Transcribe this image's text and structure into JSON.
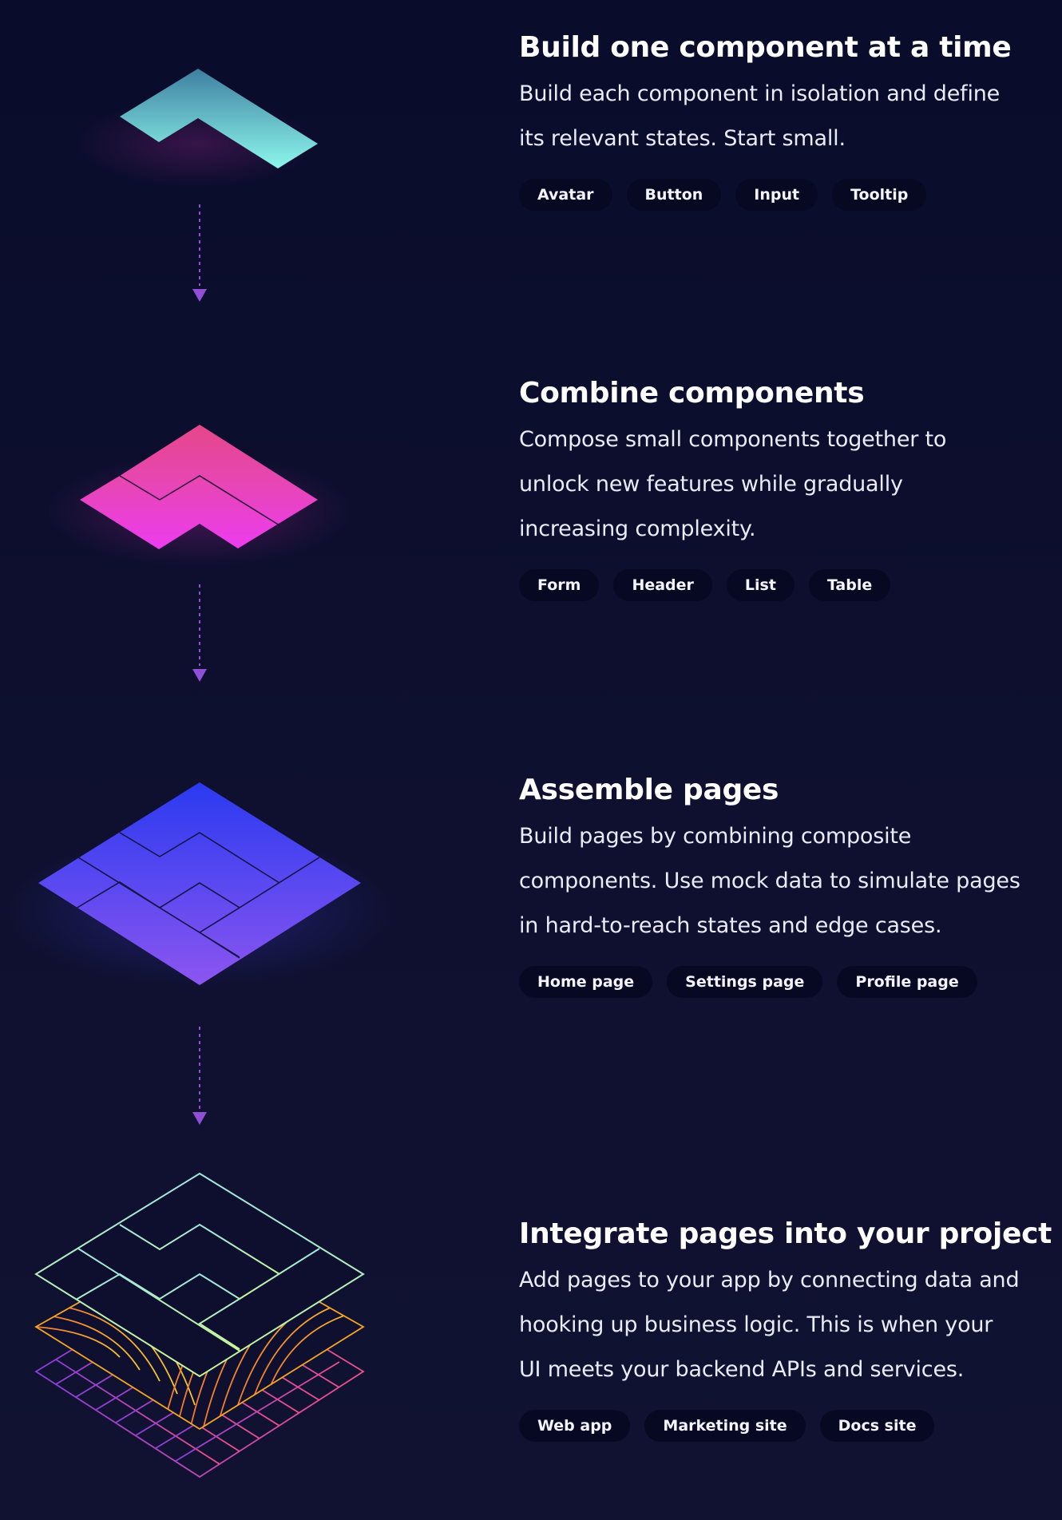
{
  "steps": [
    {
      "title": "Build one component at a time",
      "lines": [
        "Build each component in isolation and define",
        "its relevant states. Start small."
      ],
      "tags": [
        "Avatar",
        "Button",
        "Input",
        "Tooltip"
      ]
    },
    {
      "title": "Combine components",
      "lines": [
        "Compose small components together to",
        "unlock new features while gradually",
        "increasing complexity."
      ],
      "tags": [
        "Form",
        "Header",
        "List",
        "Table"
      ]
    },
    {
      "title": "Assemble pages",
      "lines": [
        "Build pages by combining composite",
        "components. Use mock data to simulate pages",
        "in hard-to-reach states and edge cases."
      ],
      "tags": [
        "Home page",
        "Settings page",
        "Profile page"
      ]
    },
    {
      "title": "Integrate pages into your project",
      "lines": [
        "Add pages to your app by connecting data and",
        "hooking up business logic. This is when your",
        "UI meets your backend APIs and services."
      ],
      "tags": [
        "Web app",
        "Marketing site",
        "Docs site"
      ]
    }
  ],
  "colors": {
    "background": "#0c0e2e",
    "tag_background": "#070821",
    "arrow": "#8f4fd6",
    "component_gradient": [
      "#3f7fa0",
      "#8cf7ec"
    ],
    "combine_gradient": [
      "#e54789",
      "#ec3cf0"
    ],
    "pages_gradient": [
      "#2e3af0",
      "#8c55f0"
    ],
    "integrate_outline": "#aef2c8",
    "integrate_contours": "#f5a623",
    "integrate_grid": [
      "#8a3fd8",
      "#f0508a"
    ]
  },
  "icons": [
    "component-layer-icon",
    "combined-layer-icon",
    "pages-layer-icon",
    "project-stack-icon",
    "down-arrow-icon"
  ]
}
